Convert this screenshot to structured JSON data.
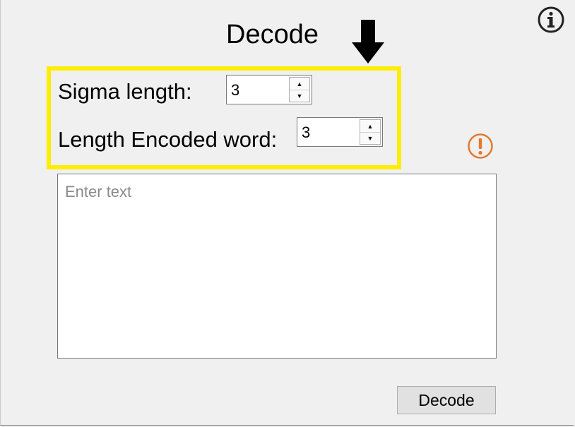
{
  "window": {
    "title": "Decode"
  },
  "icons": {
    "info": "info-icon",
    "arrow": "down-arrow-icon",
    "warning": "warning-icon"
  },
  "colors": {
    "highlight": "#ffee00",
    "warning": "#e07a2e"
  },
  "form": {
    "sigma_label": "Sigma length:",
    "sigma_value": "3",
    "length_label": "Length Encoded word:",
    "length_value": "3"
  },
  "textarea": {
    "placeholder": "Enter text",
    "value": ""
  },
  "actions": {
    "decode_label": "Decode"
  }
}
